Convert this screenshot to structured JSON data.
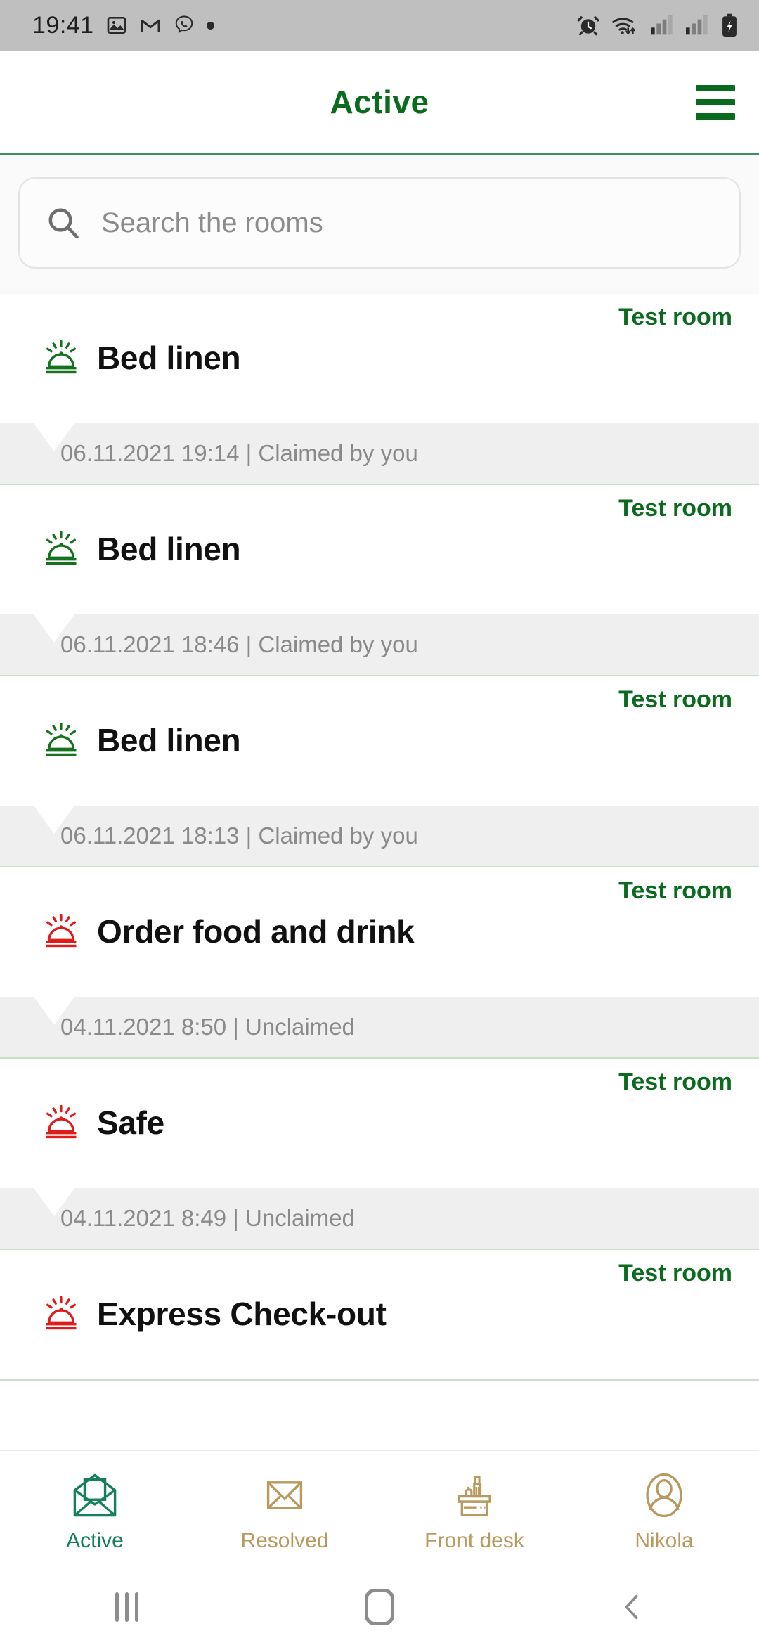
{
  "status_bar": {
    "time": "19:41",
    "left_icons": [
      "photos-icon",
      "gmail-icon",
      "viber-icon",
      "notification-dot-icon"
    ],
    "right_icons": [
      "alarm-icon",
      "wifi-icon",
      "signal-bars-icon",
      "signal-bars-2-icon",
      "battery-charging-icon"
    ]
  },
  "header": {
    "title": "Active",
    "menu_icon": "hamburger-menu-icon",
    "accent_color": "#0a6b1e"
  },
  "search": {
    "placeholder": "Search the rooms",
    "icon": "search-icon",
    "value": ""
  },
  "list": {
    "items": [
      {
        "room": "Test room",
        "title": "Bed linen",
        "icon": "service-bell-icon",
        "icon_color": "#14721e",
        "status_color": "green",
        "timestamp": "06.11.2021 19:14",
        "status": "Claimed by you",
        "meta": "06.11.2021 19:14 | Claimed by you"
      },
      {
        "room": "Test room",
        "title": "Bed linen",
        "icon": "service-bell-icon",
        "icon_color": "#14721e",
        "status_color": "green",
        "timestamp": "06.11.2021 18:46",
        "status": "Claimed by you",
        "meta": "06.11.2021 18:46 | Claimed by you"
      },
      {
        "room": "Test room",
        "title": "Bed linen",
        "icon": "service-bell-icon",
        "icon_color": "#14721e",
        "status_color": "green",
        "timestamp": "06.11.2021 18:13",
        "status": "Claimed by you",
        "meta": "06.11.2021 18:13 | Claimed by you"
      },
      {
        "room": "Test room",
        "title": "Order food and drink",
        "icon": "service-bell-icon",
        "icon_color": "#e01b1b",
        "status_color": "red",
        "timestamp": "04.11.2021 8:50",
        "status": "Unclaimed",
        "meta": "04.11.2021 8:50 | Unclaimed"
      },
      {
        "room": "Test room",
        "title": "Safe",
        "icon": "service-bell-icon",
        "icon_color": "#e01b1b",
        "status_color": "red",
        "timestamp": "04.11.2021 8:49",
        "status": "Unclaimed",
        "meta": "04.11.2021 8:49 | Unclaimed"
      },
      {
        "room": "Test room",
        "title": "Express Check-out",
        "icon": "service-bell-icon",
        "icon_color": "#e01b1b",
        "status_color": "red",
        "timestamp": "",
        "status": "",
        "meta": ""
      }
    ]
  },
  "tabbar": {
    "active_color": "#14805a",
    "inactive_color": "#b89a5e",
    "tabs": [
      {
        "label": "Active",
        "icon": "open-envelope-icon",
        "active": true
      },
      {
        "label": "Resolved",
        "icon": "closed-envelope-icon",
        "active": false
      },
      {
        "label": "Front desk",
        "icon": "front-desk-icon",
        "active": false
      },
      {
        "label": "Nikola",
        "icon": "user-profile-icon",
        "active": false
      }
    ]
  },
  "android_nav": {
    "recents_label": "recents-icon",
    "home_label": "home-icon",
    "back_label": "back-icon"
  }
}
